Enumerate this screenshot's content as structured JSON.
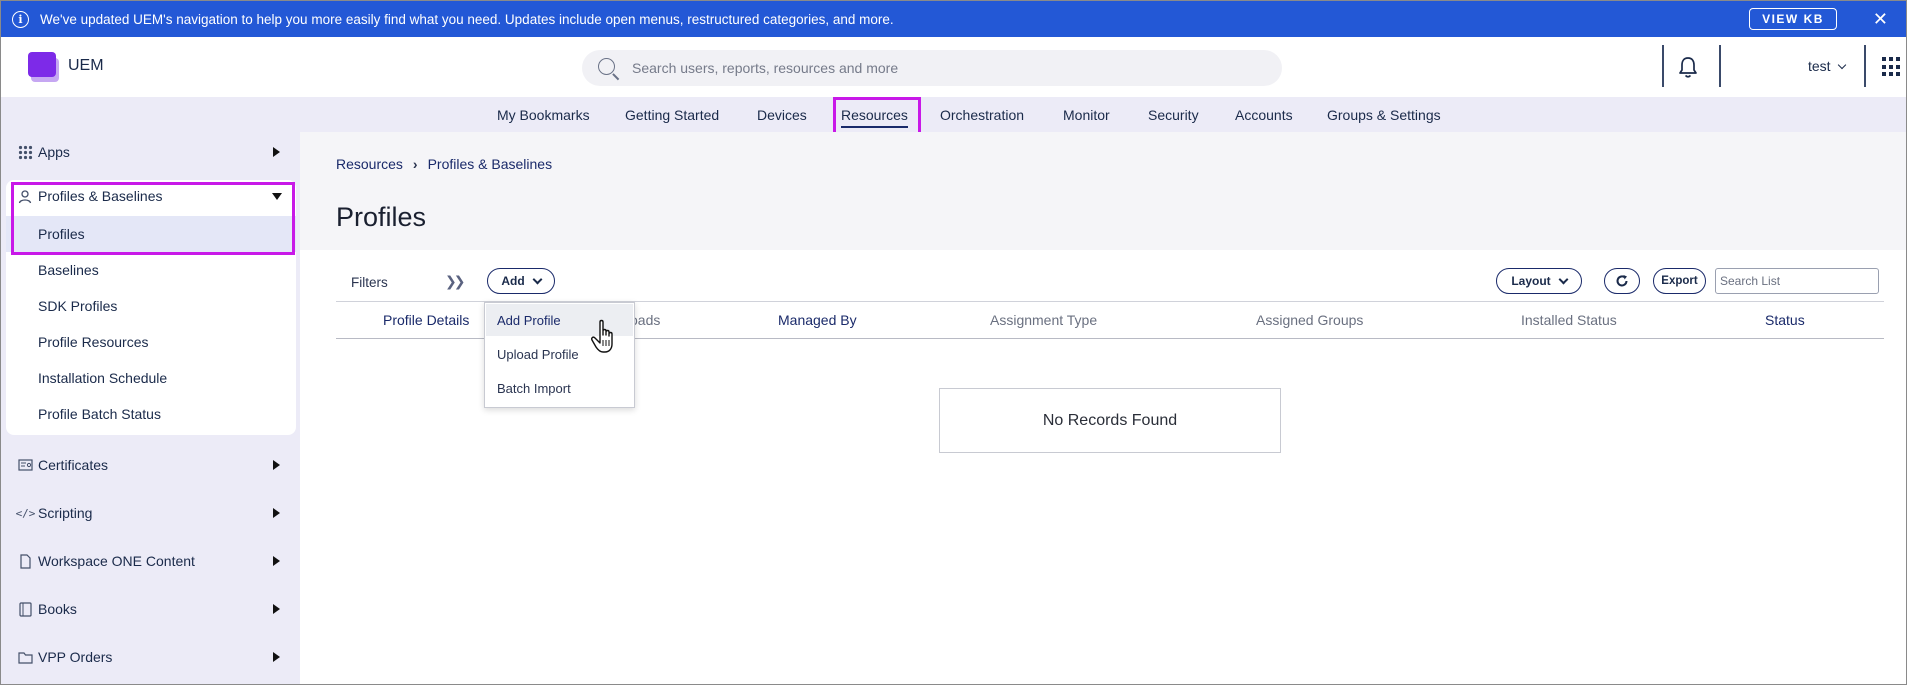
{
  "banner": {
    "message": "We've updated UEM's navigation to help you more easily find what you need. Updates include open menus, restructured categories, and more.",
    "button": "VIEW KB",
    "close": "✕"
  },
  "header": {
    "app_name": "UEM",
    "search_placeholder": "Search users, reports, resources and more",
    "user": "test"
  },
  "nav": {
    "items": [
      "My Bookmarks",
      "Getting Started",
      "Devices",
      "Resources",
      "Orchestration",
      "Monitor",
      "Security",
      "Accounts",
      "Groups & Settings"
    ],
    "active": "Resources"
  },
  "sidebar": {
    "apps": "Apps",
    "profiles_baselines": "Profiles & Baselines",
    "sub_items": [
      "Profiles",
      "Baselines",
      "SDK Profiles",
      "Profile Resources",
      "Installation Schedule",
      "Profile Batch Status"
    ],
    "selected": "Profiles",
    "certificates": "Certificates",
    "scripting": "Scripting",
    "workspace": "Workspace ONE Content",
    "books": "Books",
    "vpp": "VPP Orders"
  },
  "main": {
    "breadcrumb": [
      "Resources",
      "Profiles & Baselines"
    ],
    "title": "Profiles",
    "filters": "Filters",
    "add": "Add",
    "layout": "Layout",
    "export": "Export",
    "search_placeholder": "Search List",
    "columns": [
      "Profile Details",
      "Payloads",
      "Managed By",
      "Assignment Type",
      "Assigned Groups",
      "Installed Status",
      "Status"
    ],
    "visible_payloads_fragment": "oads",
    "empty": "No Records Found",
    "dropdown": [
      "Add Profile",
      "Upload Profile",
      "Batch Import"
    ]
  },
  "colors": {
    "banner": "#2358d6",
    "accent": "#1a2a6a",
    "highlight": "#c818e8",
    "nav_bg": "#ecebf7",
    "logo": "#7d2ae8"
  }
}
